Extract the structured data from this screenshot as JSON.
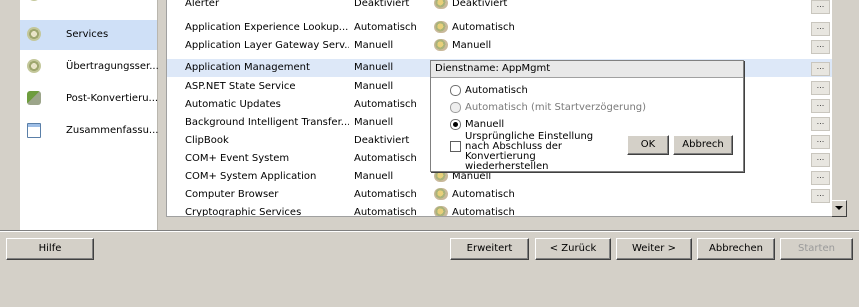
{
  "sidebar": {
    "items": [
      {
        "label": "",
        "icon": "gear-icon"
      },
      {
        "label": "Services",
        "icon": "gear-icon",
        "selected": true
      },
      {
        "label": "Übertragungsser...",
        "icon": "gear-icon"
      },
      {
        "label": "Post-Konvertieru...",
        "icon": "recycle-icon"
      },
      {
        "label": "Zusammenfassu...",
        "icon": "document-icon"
      }
    ]
  },
  "services": {
    "rows": [
      {
        "name": "Alerter",
        "startup": "Deaktiviert",
        "status": "Deaktiviert"
      },
      {
        "name": "Application Experience Lookup...",
        "startup": "Automatisch",
        "status": "Automatisch"
      },
      {
        "name": "Application Layer Gateway Serv...",
        "startup": "Manuell",
        "status": "Manuell"
      },
      {
        "name": "Application Management",
        "startup": "Manuell",
        "status": "",
        "selected": true
      },
      {
        "name": "ASP.NET State Service",
        "startup": "Manuell",
        "status": ""
      },
      {
        "name": "Automatic Updates",
        "startup": "Automatisch",
        "status": ""
      },
      {
        "name": "Background Intelligent Transfer...",
        "startup": "Manuell",
        "status": ""
      },
      {
        "name": "ClipBook",
        "startup": "Deaktiviert",
        "status": ""
      },
      {
        "name": "COM+ Event System",
        "startup": "Automatisch",
        "status": ""
      },
      {
        "name": "COM+ System Application",
        "startup": "Manuell",
        "status": "Manuell"
      },
      {
        "name": "Computer Browser",
        "startup": "Automatisch",
        "status": "Automatisch"
      },
      {
        "name": "Cryptographic Services",
        "startup": "Automatisch",
        "status": "Automatisch"
      }
    ],
    "dots_label": "..."
  },
  "popup": {
    "title": "Dienstname: AppMgmt",
    "options": [
      {
        "label": "Automatisch",
        "checked": false,
        "disabled": false
      },
      {
        "label": "Automatisch (mit Startverzögerung)",
        "checked": false,
        "disabled": true
      },
      {
        "label": "Manuell",
        "checked": true,
        "disabled": false
      }
    ],
    "checkbox_label": "Ursprüngliche Einstellung nach Abschluss der Konvertierung wiederherstellen",
    "ok_label": "OK",
    "cancel_label": "Abbrech"
  },
  "footer": {
    "help_label": "Hilfe",
    "advanced_label": "Erweitert",
    "back_label": "< Zurück",
    "next_label": "Weiter >",
    "cancel_label": "Abbrechen",
    "start_label": "Starten"
  }
}
